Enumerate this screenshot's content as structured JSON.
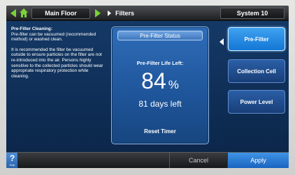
{
  "topbar": {
    "main_floor_label": "Main Floor",
    "filters_label": "Filters",
    "system_label": "System 10"
  },
  "info": {
    "title": "Pre-Filter Cleaning:",
    "paragraph1": "Pre-filter can be vacuumed (recommended method) or washed clean.",
    "paragraph2": "It is recommended the filter be vacuumed outside to ensure particles on the filter are not re-introduced into the air. Persons highly sensitive to the collected particles should wear appropriate respiratory protection while cleaning."
  },
  "status_panel": {
    "title": "Pre-Filter Status",
    "life_label": "Pre-Filter Life Left:",
    "percent_value": "84",
    "percent_unit": "%",
    "days_left": "81 days left",
    "reset_label": "Reset Timer"
  },
  "side_buttons": {
    "pre_filter": "Pre-Filter",
    "collection_cell": "Collection Cell",
    "power_level": "Power Level"
  },
  "bottombar": {
    "help_symbol": "?",
    "help_label": "Help",
    "cancel_label": "Cancel",
    "apply_label": "Apply"
  },
  "icons": {
    "back": "triangle-left-icon",
    "home": "home-icon",
    "forward": "triangle-right-icon",
    "selection": "triangle-left-icon"
  },
  "colors": {
    "nav_arrow": "#7cd13a",
    "screen_background": "#163b69",
    "active_button": "#1377d6",
    "apply_button": "#1a63c0"
  }
}
